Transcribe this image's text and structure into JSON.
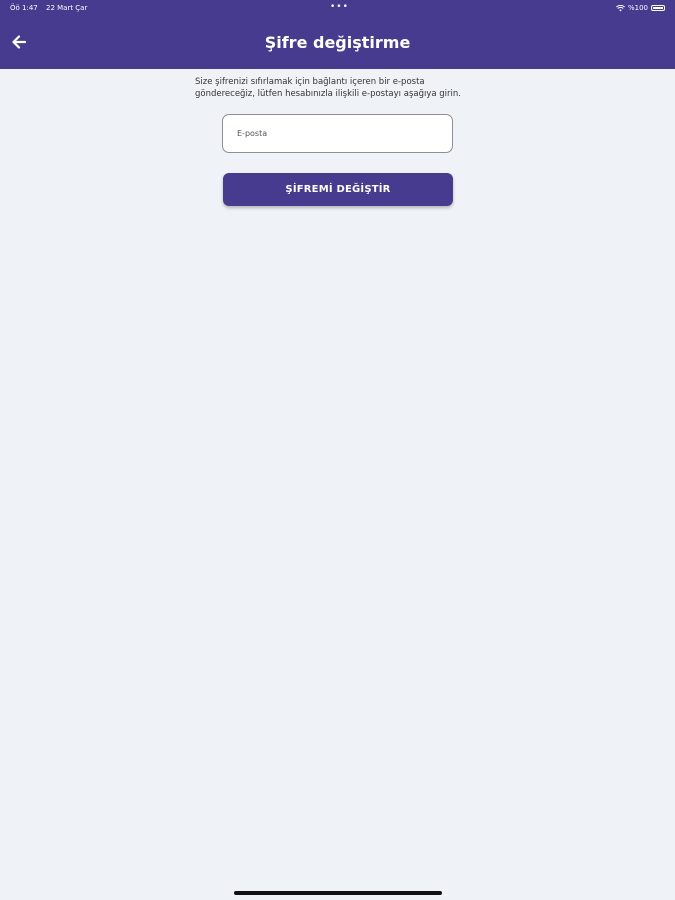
{
  "status_bar": {
    "time": "Öö 1:47",
    "date": "22 Mart Çar",
    "dots": "•••",
    "battery": "%100"
  },
  "header": {
    "title": "Şifre değiştirme",
    "back_icon": "arrow-left-icon"
  },
  "form": {
    "description_line1": "Size şifrenizi sıfırlamak için bağlantı içeren bir e-posta",
    "description_line2": "göndereceğiz, lütfen hesabınızla ilişkili e-postayı aşağıya girin.",
    "email_placeholder": "E-posta",
    "email_value": "",
    "submit_label": "ŞİFREMİ DEĞİŞTİR"
  },
  "colors": {
    "primary": "#473b8f",
    "background": "#eff3f7"
  }
}
